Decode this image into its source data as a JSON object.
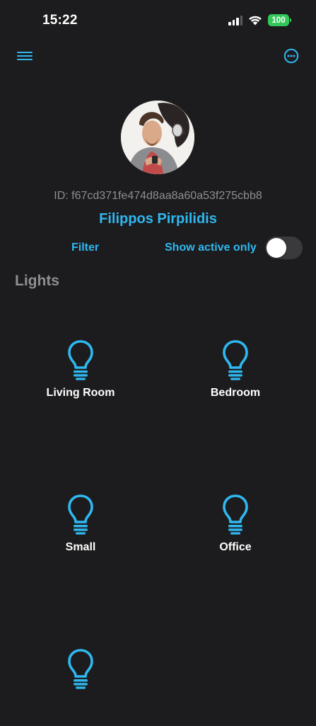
{
  "status_bar": {
    "time": "15:22",
    "battery": "100"
  },
  "nav": {
    "menu_icon": "hamburger-menu-icon",
    "more_icon": "ellipsis-circle-icon"
  },
  "profile": {
    "id_text": "ID: f67cd371fe474d8aa8a60a53f275cbb8",
    "name": "Filippos Pirpilidis"
  },
  "filters": {
    "filter_label": "Filter",
    "show_active_label": "Show active only",
    "show_active_enabled": false
  },
  "lights_section": {
    "title": "Lights",
    "items": [
      {
        "label": "Living Room",
        "icon": "lightbulb-icon"
      },
      {
        "label": "Bedroom",
        "icon": "lightbulb-icon"
      },
      {
        "label": "Small",
        "icon": "lightbulb-icon"
      },
      {
        "label": "Office",
        "icon": "lightbulb-icon"
      },
      {
        "label": "",
        "icon": "lightbulb-icon"
      }
    ]
  },
  "colors": {
    "background": "#1c1c1e",
    "accent": "#2fb8f0",
    "secondary_text": "#8e8e93",
    "battery_green": "#34c759",
    "toggle_off": "#3a3a3c"
  }
}
